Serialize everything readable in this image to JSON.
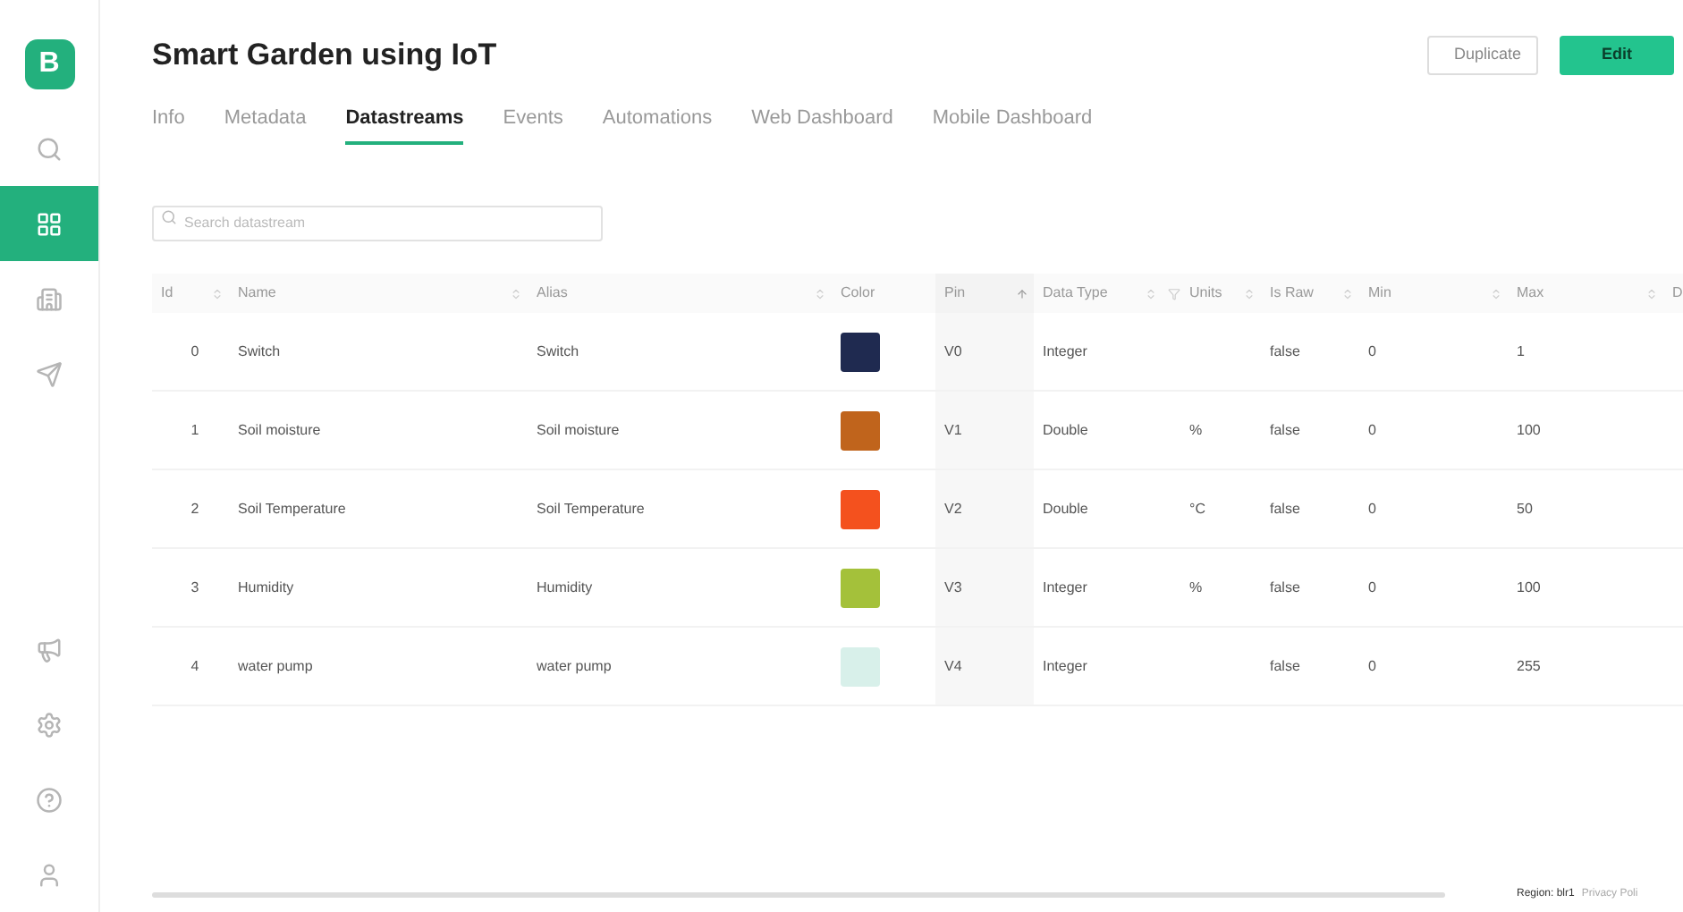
{
  "sidebar": {
    "logo": "B",
    "items": [
      {
        "kind": "search",
        "selected": false
      },
      {
        "kind": "grid",
        "selected": true
      },
      {
        "kind": "building",
        "selected": false
      },
      {
        "kind": "send",
        "selected": false
      }
    ],
    "bottom_items": [
      {
        "kind": "megaphone"
      },
      {
        "kind": "gear"
      },
      {
        "kind": "help"
      },
      {
        "kind": "user"
      }
    ]
  },
  "header": {
    "title": "Smart Garden using IoT",
    "buttons": [
      {
        "label": "Duplicate",
        "kind": "secondary"
      },
      {
        "label": "Edit",
        "kind": "primary"
      }
    ]
  },
  "tabs": [
    {
      "label": "Info",
      "selected": false
    },
    {
      "label": "Metadata",
      "selected": false
    },
    {
      "label": "Datastreams",
      "selected": true
    },
    {
      "label": "Events",
      "selected": false
    },
    {
      "label": "Automations",
      "selected": false
    },
    {
      "label": "Web Dashboard",
      "selected": false
    },
    {
      "label": "Mobile Dashboard",
      "selected": false
    }
  ],
  "search": {
    "placeholder": "Search datastream"
  },
  "table": {
    "columns": [
      "Id",
      "Name",
      "Alias",
      "Color",
      "Pin",
      "Data Type",
      "Units",
      "Is Raw",
      "Min",
      "Max",
      "D"
    ],
    "rows": [
      {
        "id": "0",
        "name": "Switch",
        "alias": "Switch",
        "color": "#1f2a50",
        "pin": "V0",
        "data_type": "Integer",
        "units": "",
        "is_raw": "false",
        "min": "0",
        "max": "1"
      },
      {
        "id": "1",
        "name": "Soil moisture",
        "alias": "Soil moisture",
        "color": "#c0641c",
        "pin": "V1",
        "data_type": "Double",
        "units": "%",
        "is_raw": "false",
        "min": "0",
        "max": "100"
      },
      {
        "id": "2",
        "name": "Soil Temperature",
        "alias": "Soil Temperature",
        "color": "#f4511e",
        "pin": "V2",
        "data_type": "Double",
        "units": "°C",
        "is_raw": "false",
        "min": "0",
        "max": "50"
      },
      {
        "id": "3",
        "name": "Humidity",
        "alias": "Humidity",
        "color": "#a4c13a",
        "pin": "V3",
        "data_type": "Integer",
        "units": "%",
        "is_raw": "false",
        "min": "0",
        "max": "100"
      },
      {
        "id": "4",
        "name": "water pump",
        "alias": "water pump",
        "color": "#d8f0ea",
        "pin": "V4",
        "data_type": "Integer",
        "units": "",
        "is_raw": "false",
        "min": "0",
        "max": "255"
      }
    ]
  },
  "footer": {
    "region": "Region: blr1",
    "link": "Privacy Poli"
  }
}
